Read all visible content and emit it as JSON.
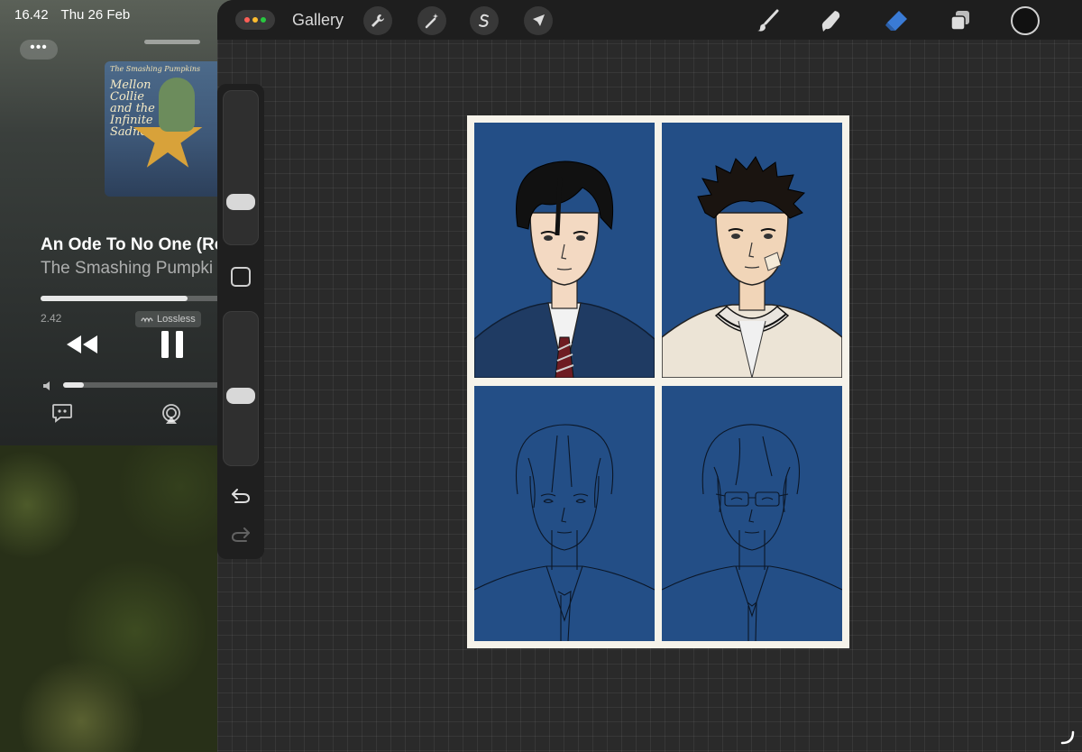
{
  "status_bar": {
    "time": "16.42",
    "date": "Thu 26 Feb"
  },
  "music_widget": {
    "more_label": "•••",
    "album": {
      "band_text": "The Smashing Pumpkins",
      "title_text": "Mellon Collie and the Infinite Sadness"
    },
    "song_title": "An Ode To No One (Re",
    "artist": "The Smashing Pumpki",
    "progress": 0.65,
    "elapsed": "2.42",
    "badge": "Lossless",
    "volume": 0.1
  },
  "procreate": {
    "gallery_label": "Gallery",
    "toolbar_left": [
      {
        "icon": "wrench-icon"
      },
      {
        "icon": "magic-wand-icon"
      },
      {
        "icon": "selection-icon"
      },
      {
        "icon": "transform-arrow-icon"
      }
    ],
    "toolbar_right": [
      {
        "icon": "brush-icon",
        "active": false
      },
      {
        "icon": "smudge-icon",
        "active": false
      },
      {
        "icon": "eraser-icon",
        "active": true
      },
      {
        "icon": "layers-icon",
        "active": false
      }
    ],
    "accent_color": "#3a7bd5",
    "current_color": "#111111",
    "sidebar": {
      "brush_size": 0.25,
      "opacity": 0.45
    },
    "artwork": {
      "background": "#f6f3ea",
      "panel_color": "#234e86",
      "panels": [
        {
          "name": "portrait-dark-hair-sweater",
          "state": "colored"
        },
        {
          "name": "portrait-spiky-hair-bandage",
          "state": "colored"
        },
        {
          "name": "portrait-lineart-1",
          "state": "lineart"
        },
        {
          "name": "portrait-lineart-glasses",
          "state": "lineart"
        }
      ]
    }
  }
}
